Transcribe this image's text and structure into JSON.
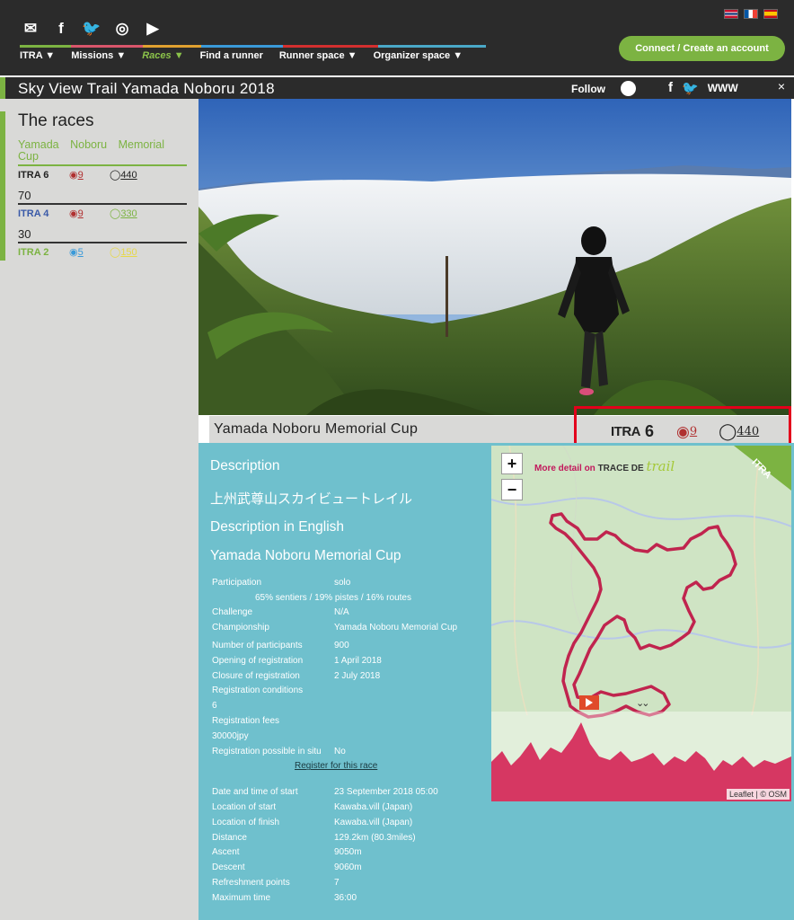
{
  "nav": {
    "items": [
      {
        "label": "ITRA ▼",
        "active": false
      },
      {
        "label": "Missions ▼",
        "active": false
      },
      {
        "label": "Races ▼",
        "active": true
      },
      {
        "label": "Find a runner",
        "active": false
      },
      {
        "label": "Runner space ▼",
        "active": false
      },
      {
        "label": "Organizer space ▼",
        "active": false
      }
    ],
    "connect_label": "Connect / Create an account",
    "strip_colors": [
      "#7cb342",
      "#d9556b",
      "#e0a030",
      "#3a9ad9",
      "#d32f2f",
      "#4aa8c8"
    ]
  },
  "title_bar": {
    "title": "Sky View Trail Yamada Noboru 2018",
    "follow_label": "Follow",
    "www_label": "WWW",
    "close_label": "×"
  },
  "sidebar": {
    "heading": "The races",
    "race_name": "Yamada Noboru Memorial Cup",
    "rows": [
      {
        "itra": "ITRA 6",
        "points": "9",
        "distance": "440"
      },
      {
        "itra": "ITRA 4",
        "points": "9",
        "distance": "330"
      },
      {
        "itra": "ITRA 2",
        "points": "5",
        "distance": "150"
      }
    ],
    "distances": [
      "70",
      "30"
    ]
  },
  "race": {
    "name": "Yamada Noboru Memorial Cup",
    "itra_label": "ITRA",
    "itra_score": "6",
    "points": "9",
    "distance_points": "440"
  },
  "description": {
    "heading": "Description",
    "text": "上州武尊山スカイビュートレイル",
    "english_heading": "Description in English",
    "english_text": "Yamada Noboru Memorial Cup"
  },
  "info": {
    "participation_label": "Participation",
    "participation_value": "solo",
    "terrain": "65% sentiers / 19% pistes / 16% routes",
    "rows1": [
      {
        "k": "Challenge",
        "v": "N/A"
      },
      {
        "k": "Championship",
        "v": "Yamada Noboru Memorial Cup"
      }
    ],
    "rows2": [
      {
        "k": "Number of participants",
        "v": "900"
      },
      {
        "k": "Opening of registration",
        "v": "1 April 2018"
      },
      {
        "k": "Closure of registration",
        "v": "2 July 2018"
      }
    ],
    "reg_conditions_label": "Registration conditions",
    "reg_conditions_value": "6",
    "reg_fees_label": "Registration fees",
    "reg_fees_value": "30000jpy",
    "reg_situ_label": "Registration possible in situ",
    "reg_situ_value": "No",
    "register_link": "Register for this race",
    "rows3": [
      {
        "k": "Date and time of start",
        "v": "23 September 2018 05:00"
      },
      {
        "k": "Location of start",
        "v": "Kawaba.vill (Japan)"
      },
      {
        "k": "Location of finish",
        "v": "Kawaba.vill (Japan)"
      },
      {
        "k": "Distance",
        "v": "129.2km (80.3miles)"
      },
      {
        "k": "Ascent",
        "v": "9050m"
      },
      {
        "k": "Descent",
        "v": "9060m"
      },
      {
        "k": "Refreshment points",
        "v": "7"
      },
      {
        "k": "Maximum time",
        "v": "36:00"
      }
    ]
  },
  "map": {
    "zoom_in": "+",
    "zoom_out": "−",
    "trace_prefix": "More detail on",
    "trace_name": "TRACE DE",
    "trace_script": "trail",
    "ribbon": "ITRA",
    "attribution": "Leaflet | © OSM",
    "expand_label": "⌄⌄"
  }
}
